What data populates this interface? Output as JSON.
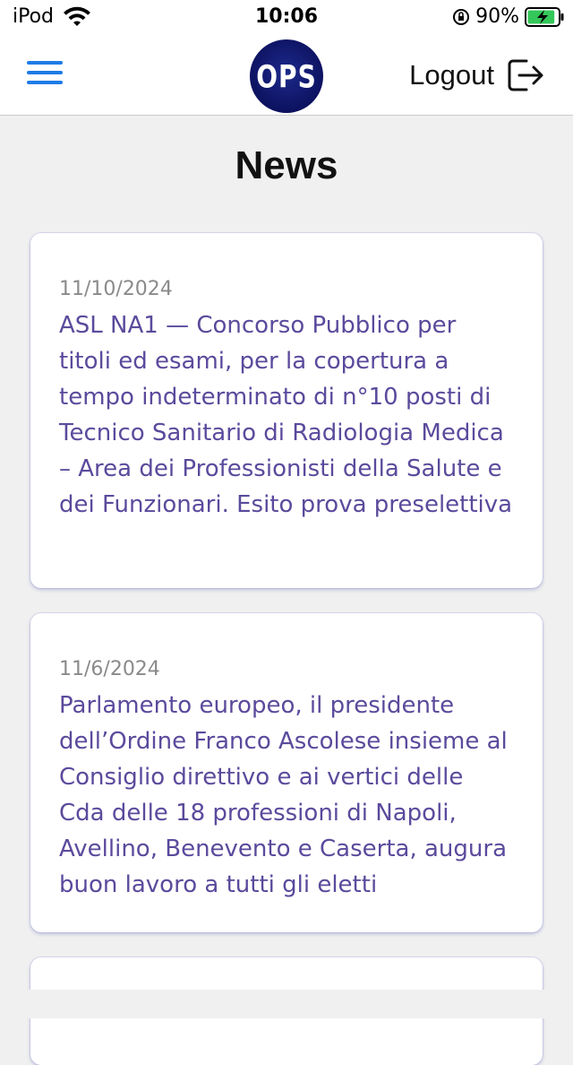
{
  "status_bar": {
    "carrier": "iPod",
    "time": "10:06",
    "battery_percent": "90%",
    "battery_level": 0.9,
    "icons": [
      "wifi-icon",
      "orientation-lock-icon",
      "battery-charging-icon"
    ]
  },
  "header": {
    "logo_text": "OPS",
    "logout_label": "Logout",
    "icons": [
      "menu-icon",
      "logout-icon"
    ],
    "accent_color": "#1f7be6"
  },
  "page": {
    "title": "News"
  },
  "news": [
    {
      "date": "11/10/2024",
      "title": "ASL NA1 — Concorso Pubblico per titoli ed esami, per la copertura a tempo indeterminato di n°10 posti di Tecnico Sanitario di Radiologia Medica – Area dei Professionisti della Salute e dei Funzionari. Esito prova preselettiva"
    },
    {
      "date": "11/6/2024",
      "title": "Parlamento europeo, il presidente dell’Ordine Franco Ascolese insieme al Consiglio direttivo e ai vertici delle Cda delle 18 professioni di Napoli, Avellino, Benevento e Caserta, augura buon lavoro a tutti gli eletti"
    }
  ],
  "colors": {
    "news_title": "#5b4a9c",
    "news_date": "#8a8a8a",
    "background": "#f0f0f0",
    "logo_bg": "#0d1260"
  }
}
